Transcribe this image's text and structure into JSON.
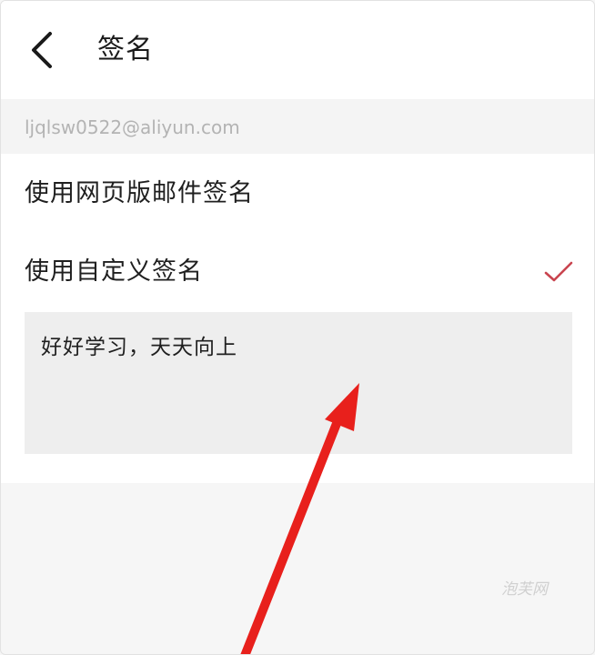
{
  "header": {
    "title": "签名",
    "back_icon": "chevron-left-icon"
  },
  "account": {
    "email": "ljqlsw0522@aliyun.com"
  },
  "options": {
    "web_signature_label": "使用网页版邮件签名",
    "custom_signature_label": "使用自定义签名",
    "selected": "custom",
    "check_icon": "checkmark-icon",
    "accent_color": "#c9444f"
  },
  "signature": {
    "text": "好好学习，天天向上"
  },
  "annotation": {
    "arrow_color": "#e8201c"
  },
  "watermark": {
    "text": "泡芙网"
  }
}
